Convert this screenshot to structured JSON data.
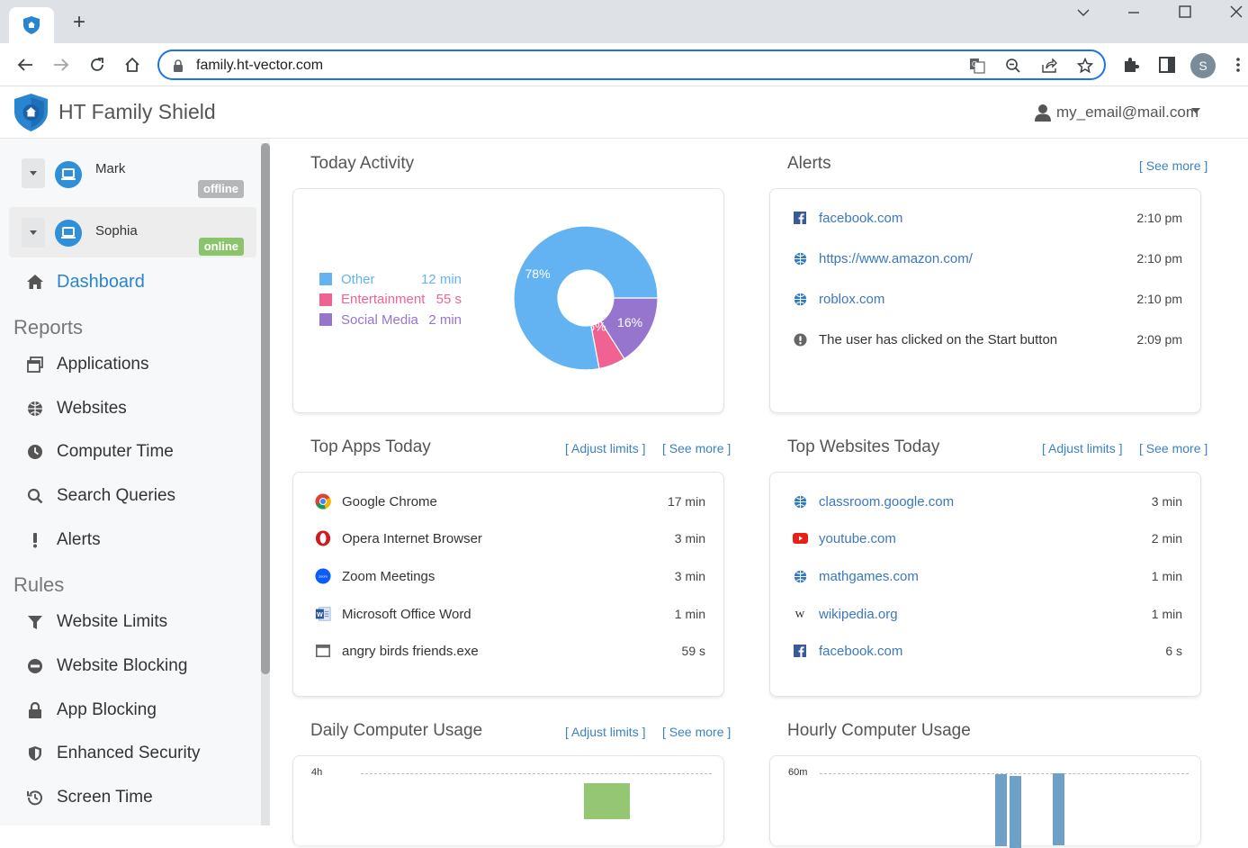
{
  "browser": {
    "url": "family.ht-vector.com",
    "profile_initial": "S",
    "new_tab_label": "+",
    "window_controls": {
      "minimize": "—",
      "maximize": "☐",
      "close": "✕",
      "tab_search": "⌄"
    }
  },
  "app": {
    "title": "HT Family Shield",
    "user_email": "my_email@mail.com",
    "brand_color": "#2a85d0"
  },
  "sidebar": {
    "devices": [
      {
        "name": "Mark",
        "status": "offline",
        "active": false
      },
      {
        "name": "Sophia",
        "status": "online",
        "active": true
      }
    ],
    "dashboard_label": "Dashboard",
    "reports_heading": "Reports",
    "reports": [
      {
        "label": "Applications",
        "icon": "window-icon"
      },
      {
        "label": "Websites",
        "icon": "globe-icon"
      },
      {
        "label": "Computer Time",
        "icon": "clock-icon"
      },
      {
        "label": "Search Queries",
        "icon": "search-icon"
      },
      {
        "label": "Alerts",
        "icon": "exclamation-icon"
      }
    ],
    "rules_heading": "Rules",
    "rules": [
      {
        "label": "Website Limits",
        "icon": "filter-icon"
      },
      {
        "label": "Website Blocking",
        "icon": "minus-circle-icon"
      },
      {
        "label": "App Blocking",
        "icon": "lock-icon"
      },
      {
        "label": "Enhanced Security",
        "icon": "shield-icon"
      },
      {
        "label": "Screen Time",
        "icon": "history-icon"
      }
    ]
  },
  "today_activity": {
    "title": "Today Activity",
    "legend": [
      {
        "label": "Other",
        "value": "12 min",
        "color": "#63b3f3"
      },
      {
        "label": "Entertainment",
        "value": "55 s",
        "color": "#f06292"
      },
      {
        "label": "Social Media",
        "value": "2 min",
        "color": "#9575cd"
      }
    ]
  },
  "chart_data": [
    {
      "type": "pie",
      "title": "Today Activity",
      "categories": [
        "Other",
        "Entertainment",
        "Social Media"
      ],
      "values": [
        78,
        6,
        16
      ],
      "labels": [
        "78%",
        "6%",
        "16%"
      ],
      "colors": [
        "#63b3f3",
        "#f06292",
        "#9575cd"
      ],
      "donut": true
    },
    {
      "type": "bar",
      "title": "Daily Computer Usage",
      "ytick_labels": [
        "4h"
      ],
      "bar_color": "#95c673",
      "visible_bar_count": 1,
      "note": "chart cropped at bottom; only top of one bar visible (~3.5h)"
    },
    {
      "type": "bar",
      "title": "Hourly Computer Usage",
      "ytick_labels": [
        "60m"
      ],
      "bar_color": "#6fa1c8",
      "visible_bar_count": 3,
      "values_approx": [
        57,
        52,
        60
      ],
      "note": "chart cropped at bottom"
    }
  ],
  "alerts": {
    "title": "Alerts",
    "see_more": "[ See more ]",
    "items": [
      {
        "icon": "facebook-icon",
        "text": "facebook.com",
        "time": "2:10 pm",
        "link": true
      },
      {
        "icon": "globe-icon",
        "text": "https://www.amazon.com/",
        "time": "2:10 pm",
        "link": true
      },
      {
        "icon": "globe-icon",
        "text": "roblox.com",
        "time": "2:10 pm",
        "link": true
      },
      {
        "icon": "exclamation-circle-icon",
        "text": "The user has clicked on the Start button",
        "time": "2:09 pm",
        "link": false
      }
    ]
  },
  "top_apps": {
    "title": "Top Apps Today",
    "adjust_limits": "[ Adjust limits ]",
    "see_more": "[ See more ]",
    "items": [
      {
        "icon": "chrome-icon",
        "name": "Google Chrome",
        "time": "17 min"
      },
      {
        "icon": "opera-icon",
        "name": "Opera Internet Browser",
        "time": "3 min"
      },
      {
        "icon": "zoom-icon",
        "name": "Zoom Meetings",
        "time": "3 min"
      },
      {
        "icon": "word-icon",
        "name": "Microsoft Office Word",
        "time": "1 min"
      },
      {
        "icon": "app-window-icon",
        "name": "angry birds friends.exe",
        "time": "59 s"
      }
    ]
  },
  "top_websites": {
    "title": "Top Websites Today",
    "adjust_limits": "[ Adjust limits ]",
    "see_more": "[ See more ]",
    "items": [
      {
        "icon": "globe-icon",
        "name": "classroom.google.com",
        "time": "3 min"
      },
      {
        "icon": "youtube-icon",
        "name": "youtube.com",
        "time": "2 min"
      },
      {
        "icon": "globe-icon",
        "name": "mathgames.com",
        "time": "1 min"
      },
      {
        "icon": "wikipedia-icon",
        "name": "wikipedia.org",
        "time": "1 min"
      },
      {
        "icon": "facebook-icon",
        "name": "facebook.com",
        "time": "6 s"
      }
    ]
  },
  "daily_usage": {
    "title": "Daily Computer Usage",
    "adjust_limits": "[ Adjust limits ]",
    "see_more": "[ See more ]",
    "y_label": "4h"
  },
  "hourly_usage": {
    "title": "Hourly Computer Usage",
    "y_label": "60m"
  }
}
